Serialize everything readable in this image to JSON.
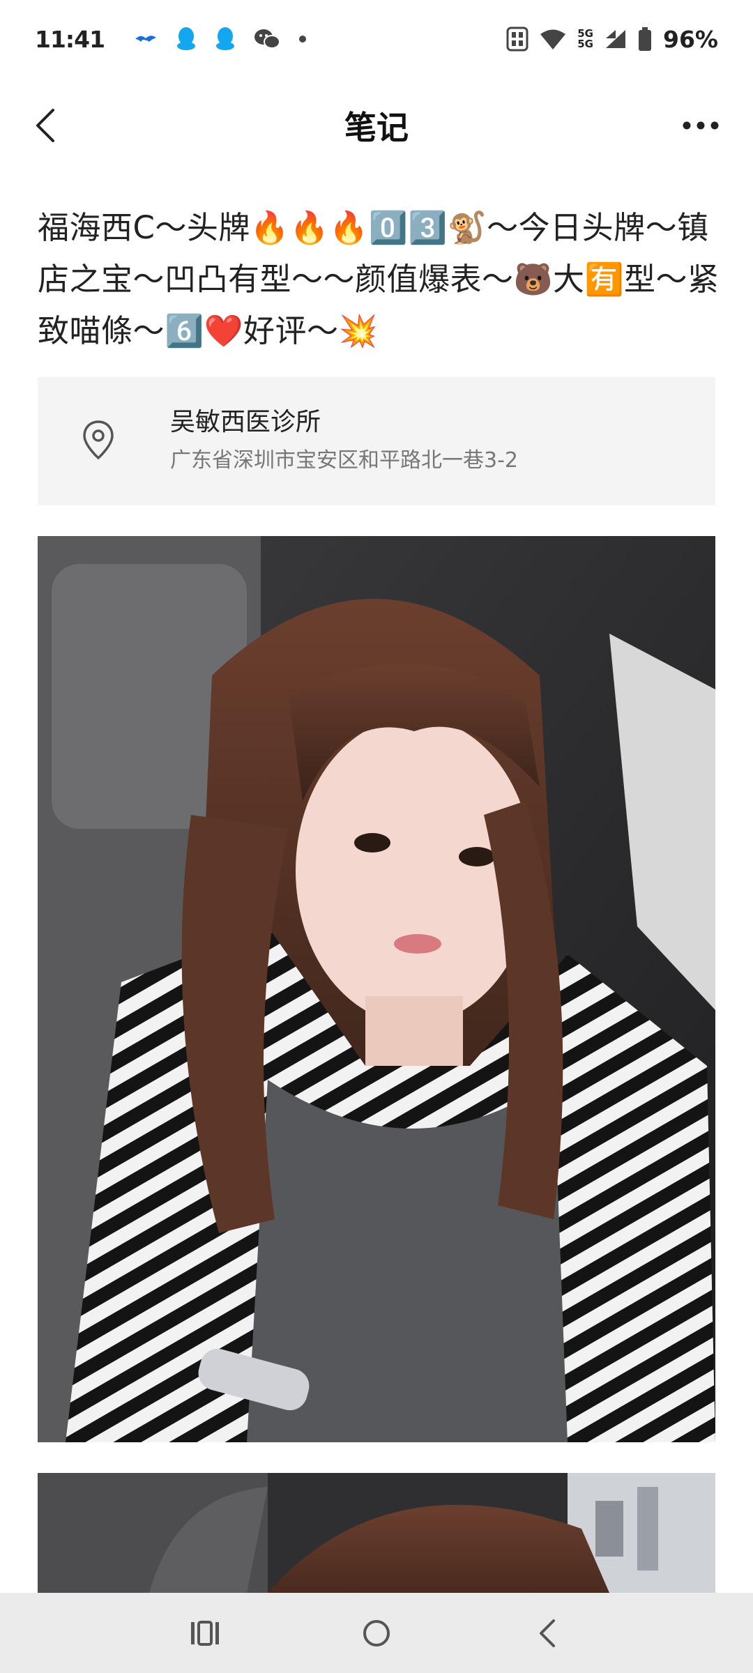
{
  "status_bar": {
    "time": "11:41",
    "battery": "96%",
    "network_top": "5G",
    "network_bottom": "5G",
    "notification_icons": [
      "bird-icon",
      "qq-icon",
      "qq-icon",
      "wechat-icon",
      "dot-icon"
    ],
    "system_icons": [
      "nfc-icon",
      "wifi-icon",
      "signal-icon",
      "battery-icon"
    ]
  },
  "header": {
    "title": "笔记",
    "back_icon": "chevron-left-icon",
    "more_icon": "more-dots-icon"
  },
  "note": {
    "title": "福海西C～头牌🔥🔥🔥0️⃣3️⃣🐒～今日头牌～镇店之宝～凹凸有型～～颜值爆表～🐻大🈶型～紧致喵條～6️⃣❤️好评～💥"
  },
  "location": {
    "icon": "location-pin-icon",
    "name": "吴敏西医诊所",
    "address": "广东省深圳市宝安区和平路北一巷3-2"
  },
  "photos": [
    {
      "icon": "photo-selfie-car"
    },
    {
      "icon": "photo-selfie-car-partial"
    }
  ],
  "nav_bar": {
    "recents_icon": "recents-icon",
    "home_icon": "home-circle-icon",
    "back_icon": "back-chevron-icon"
  },
  "colors": {
    "background": "#ffffff",
    "card_bg": "#f4f4f4",
    "nav_bg": "#ebebeb",
    "text_primary": "#222222",
    "text_secondary": "#777777"
  }
}
